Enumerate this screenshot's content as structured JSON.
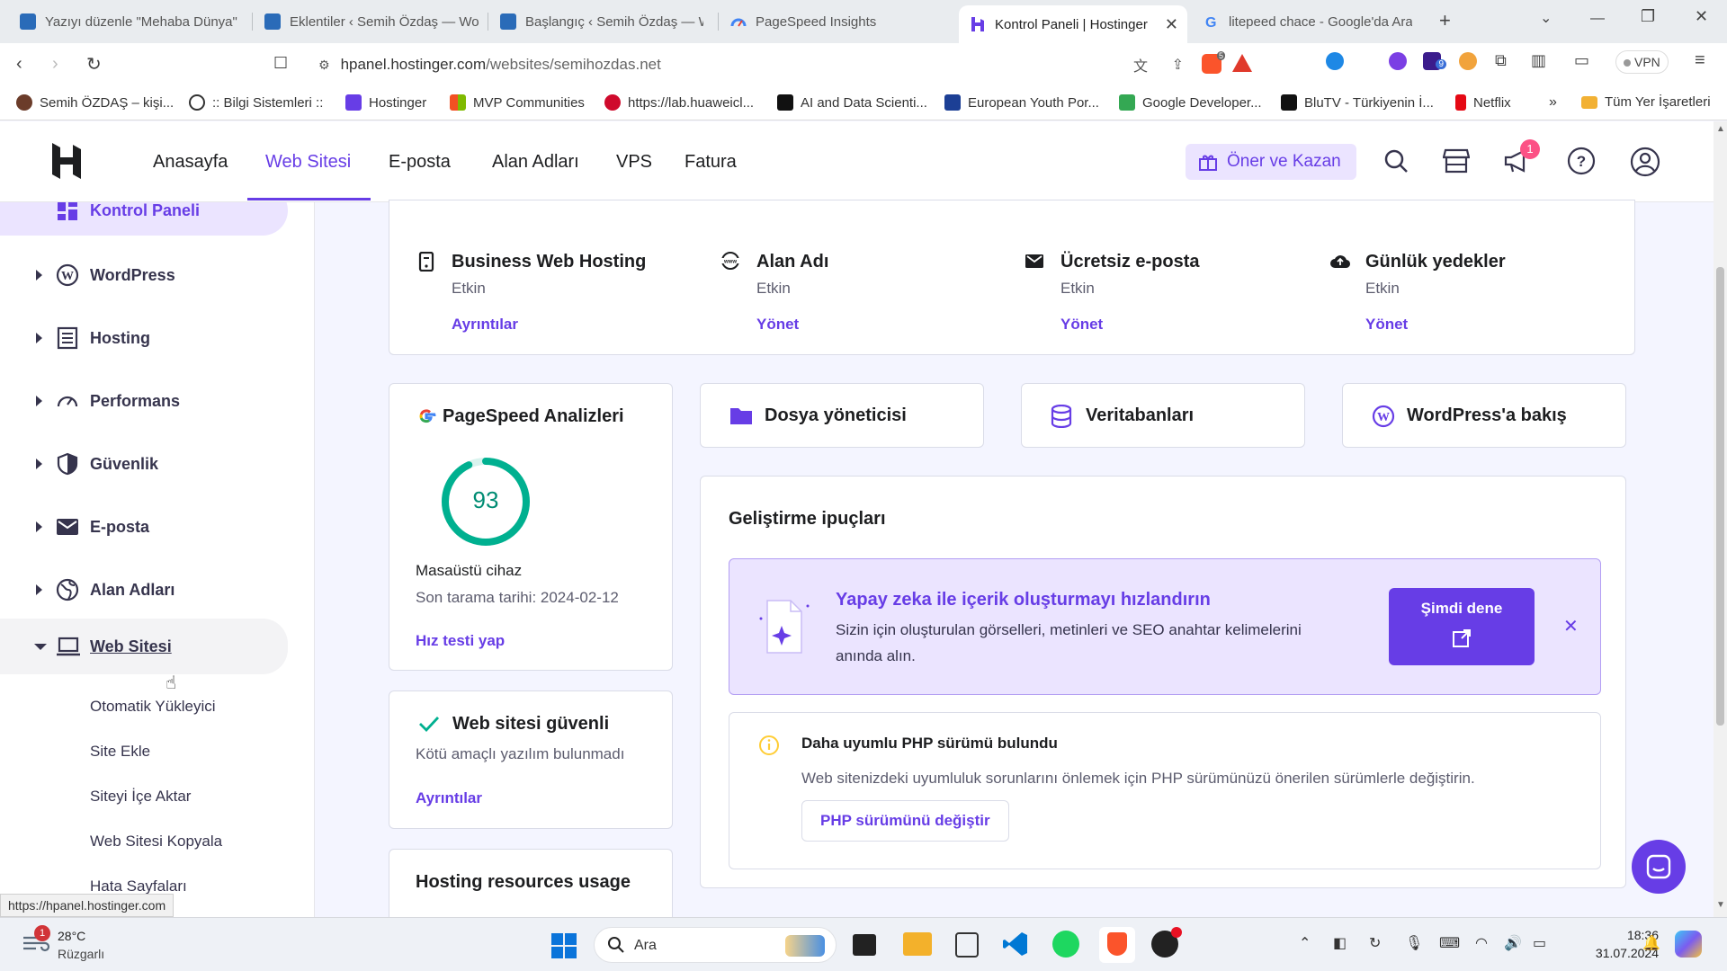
{
  "browser": {
    "tabs": [
      {
        "title": "Yazıyı düzenle \"Mehaba Dünya\""
      },
      {
        "title": "Eklentiler ‹ Semih Özdaş — Wo"
      },
      {
        "title": "Başlangıç ‹ Semih Özdaş — W"
      },
      {
        "title": "PageSpeed Insights"
      },
      {
        "title": "Kontrol Paneli | Hostinger"
      },
      {
        "title": "litepeed chace - Google'da Ara"
      }
    ],
    "url_host": "hpanel.hostinger.com",
    "url_path": "/websites/semihozdas.net",
    "vpn_label": "VPN",
    "ext_badge": "9",
    "brave_badge": "5",
    "bookmarks": [
      "Semih ÖZDAŞ – kişi...",
      ":: Bilgi Sistemleri ::",
      "Hostinger",
      "MVP Communities",
      "https://lab.huaweicl...",
      "AI and Data Scienti...",
      "European Youth Por...",
      "Google Developer...",
      "BluTV - Türkiyenin İ...",
      "Netflix"
    ],
    "bookmarks_more": "»",
    "all_bookmarks": "Tüm Yer İşaretleri",
    "status_url": "https://hpanel.hostinger.com"
  },
  "header": {
    "nav": [
      "Anasayfa",
      "Web Sitesi",
      "E-posta",
      "Alan Adları",
      "VPS",
      "Fatura"
    ],
    "refer_label": "Öner ve Kazan",
    "notif_count": "1"
  },
  "sidebar": {
    "top_item": "Kontrol Paneli",
    "items": [
      "WordPress",
      "Hosting",
      "Performans",
      "Güvenlik",
      "E-posta",
      "Alan Adları"
    ],
    "expanded": "Web Sitesi",
    "sub_items": [
      "Otomatik Yükleyici",
      "Site Ekle",
      "Siteyi İçe Aktar",
      "Web Sitesi Kopyala",
      "Hata Sayfaları"
    ]
  },
  "services": [
    {
      "name": "Business Web Hosting",
      "status": "Etkin",
      "action": "Ayrıntılar"
    },
    {
      "name": "Alan Adı",
      "status": "Etkin",
      "action": "Yönet"
    },
    {
      "name": "Ücretsiz e-posta",
      "status": "Etkin",
      "action": "Yönet"
    },
    {
      "name": "Günlük yedekler",
      "status": "Etkin",
      "action": "Yönet"
    }
  ],
  "pagespeed": {
    "title": "PageSpeed Analizleri",
    "score": "93",
    "score_fraction": 0.93,
    "device": "Masaüstü cihaz",
    "last_scan": "Son tarama tarihi: 2024-02-12",
    "action": "Hız testi yap"
  },
  "quick": [
    "Dosya yöneticisi",
    "Veritabanları",
    "WordPress'a bakış"
  ],
  "security": {
    "title": "Web sitesi güvenli",
    "desc": "Kötü amaçlı yazılım bulunmadı",
    "action": "Ayrıntılar"
  },
  "resources_title": "Hosting resources usage",
  "tips": {
    "title": "Geliştirme ipuçları",
    "ai_title": "Yapay zeka ile içerik oluşturmayı hızlandırın",
    "ai_desc": "Sizin için oluşturulan görselleri, metinleri ve SEO anahtar kelimelerini anında alın.",
    "ai_button": "Şimdi dene",
    "php_title": "Daha uyumlu PHP sürümü bulundu",
    "php_desc": "Web sitenizdeki uyumluluk sorunlarını önlemek için PHP sürümünüzü önerilen sürümlerle değiştirin.",
    "php_button": "PHP sürümünü değiştir"
  },
  "taskbar": {
    "weather_temp": "28°C",
    "weather_desc": "Rüzgarlı",
    "weather_badge": "1",
    "search": "Ara",
    "time": "18:36",
    "date": "31.07.2024"
  },
  "colors": {
    "accent": "#673de6",
    "success": "#00b090",
    "ai_bg": "#ebe4ff"
  }
}
